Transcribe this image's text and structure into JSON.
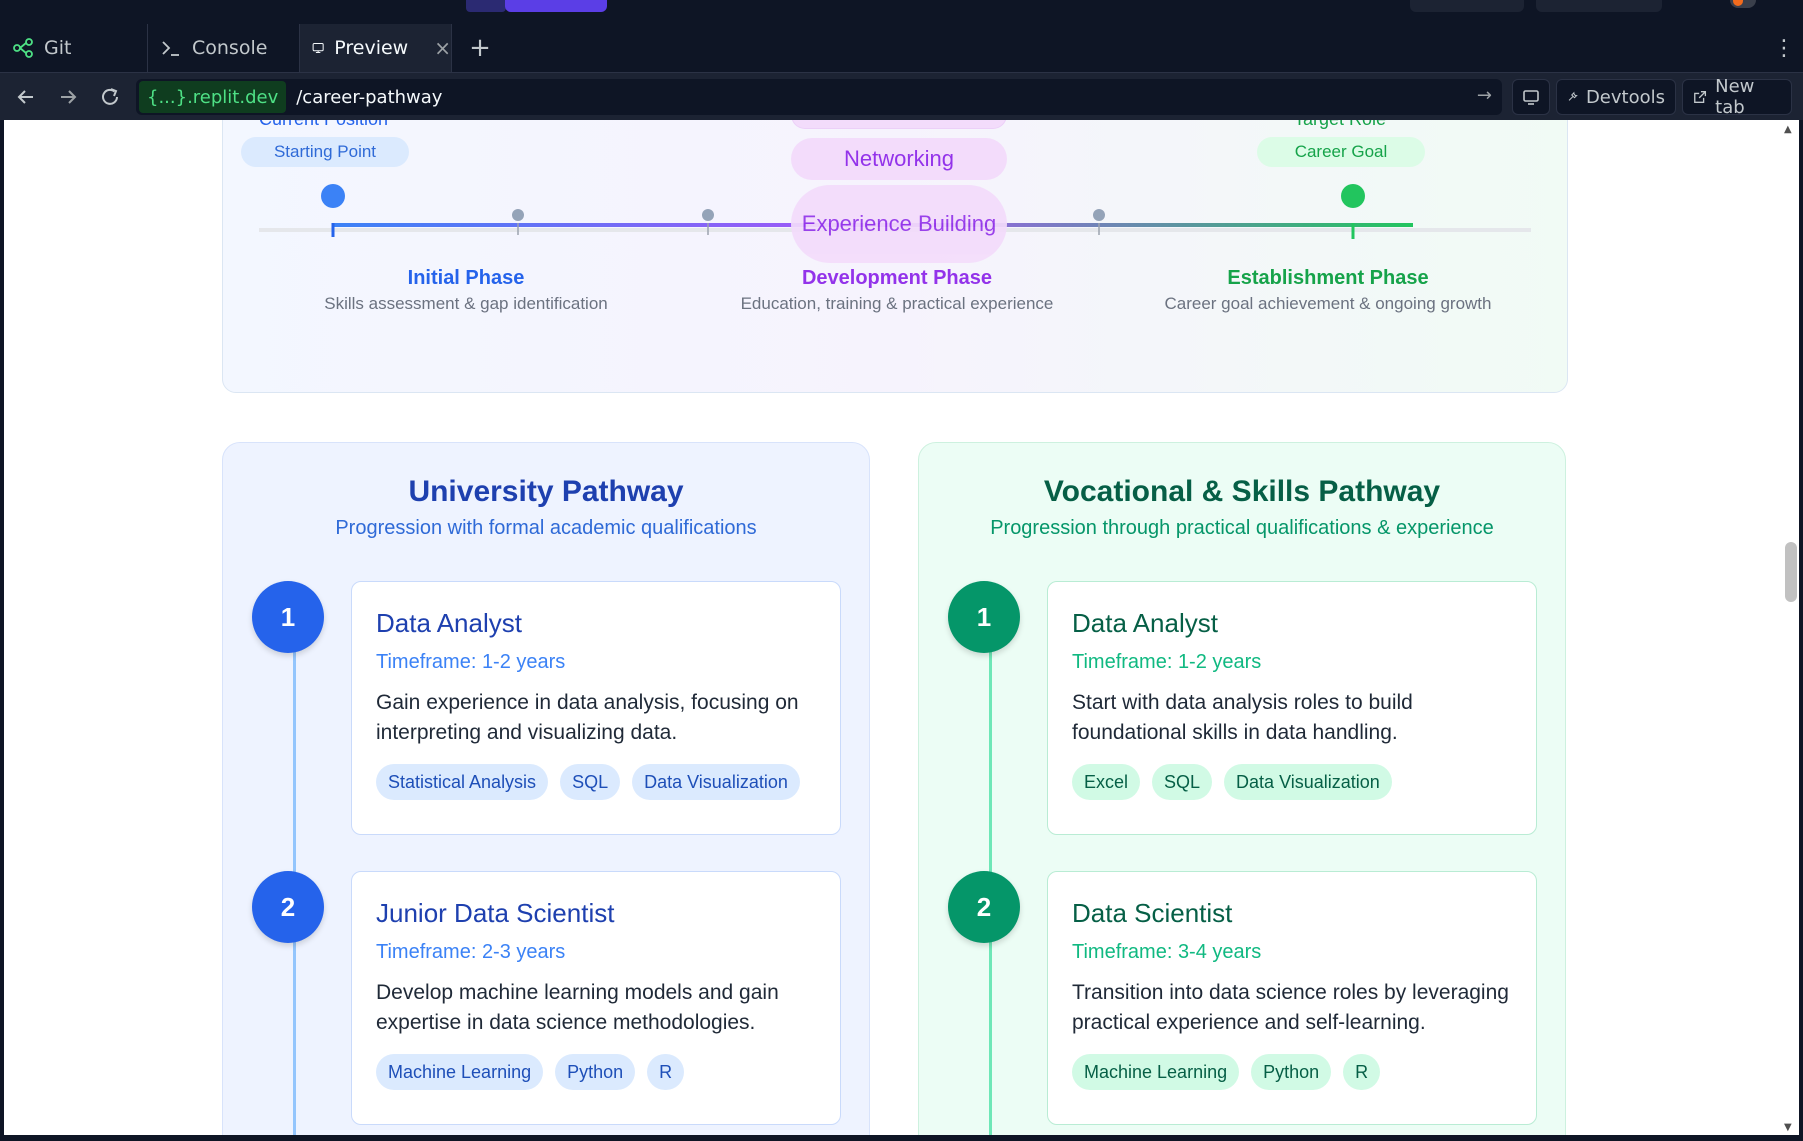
{
  "tabs": {
    "git": "Git",
    "console": "Console",
    "preview": "Preview",
    "add": "+",
    "close": "×",
    "menu": "⋮"
  },
  "urlbar": {
    "domain": "{...}.replit.dev",
    "path": "/career-pathway",
    "devtools": "Devtools",
    "new_tab": "New tab"
  },
  "timeline": {
    "start_label": "Current Position",
    "start_pill": "Starting Point",
    "goal_label": "Target Role",
    "goal_pill": "Career Goal",
    "middle_pills": [
      "Networking",
      "Experience Building"
    ],
    "phases": [
      {
        "title": "Initial Phase",
        "desc": "Skills assessment & gap identification",
        "color": "#2563eb"
      },
      {
        "title": "Development Phase",
        "desc": "Education, training & practical experience",
        "color": "#9333ea"
      },
      {
        "title": "Establishment Phase",
        "desc": "Career goal achievement & ongoing growth",
        "color": "#16a34a"
      }
    ]
  },
  "university": {
    "title": "University Pathway",
    "subtitle": "Progression with formal academic qualifications",
    "steps": [
      {
        "num": "1",
        "title": "Data Analyst",
        "timeframe": "Timeframe: 1-2 years",
        "desc": "Gain experience in data analysis, focusing on interpreting and visualizing data.",
        "tags": [
          "Statistical Analysis",
          "SQL",
          "Data Visualization"
        ]
      },
      {
        "num": "2",
        "title": "Junior Data Scientist",
        "timeframe": "Timeframe: 2-3 years",
        "desc": "Develop machine learning models and gain expertise in data science methodologies.",
        "tags": [
          "Machine Learning",
          "Python",
          "R"
        ]
      }
    ]
  },
  "vocational": {
    "title": "Vocational & Skills Pathway",
    "subtitle": "Progression through practical qualifications & experience",
    "steps": [
      {
        "num": "1",
        "title": "Data Analyst",
        "timeframe": "Timeframe: 1-2 years",
        "desc": "Start with data analysis roles to build foundational skills in data handling.",
        "tags": [
          "Excel",
          "SQL",
          "Data Visualization"
        ]
      },
      {
        "num": "2",
        "title": "Data Scientist",
        "timeframe": "Timeframe: 3-4 years",
        "desc": "Transition into data science roles by leveraging practical experience and self-learning.",
        "tags": [
          "Machine Learning",
          "Python",
          "R"
        ]
      }
    ]
  },
  "colors": {
    "blue": "#2563eb",
    "purple": "#9333ea",
    "green": "#16a34a",
    "emerald": "#059669"
  },
  "icons": [
    "git-icon",
    "console-icon",
    "preview-icon",
    "back-icon",
    "forward-icon",
    "reload-icon",
    "arrow-right-icon",
    "screen-icon",
    "wrench-icon",
    "external-link-icon"
  ]
}
